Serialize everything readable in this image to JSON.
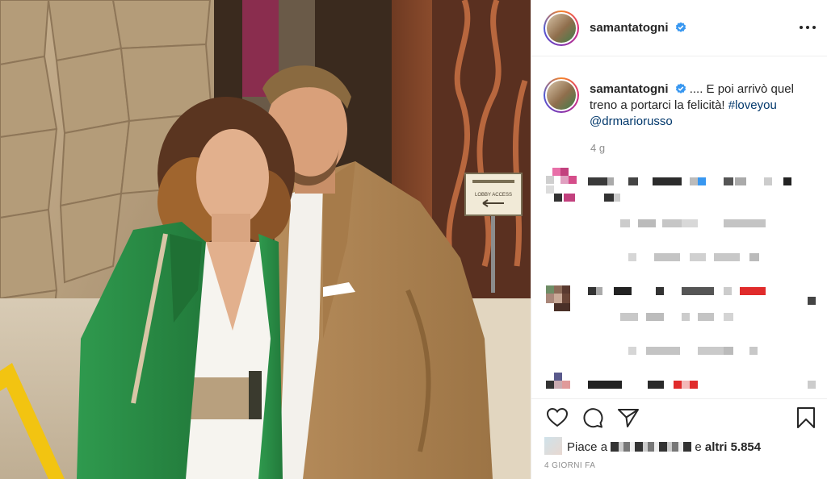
{
  "post": {
    "username": "samantatogni",
    "verified": true,
    "more_label": "Altre opzioni"
  },
  "caption": {
    "username": "samantatogni",
    "text": ".... E poi arrivò quel treno a portarci la felicità! ",
    "hashtag": "#loveyou",
    "mention": "@drmariorusso",
    "time": "4 g"
  },
  "likes": {
    "prefix": "Piace a ",
    "separator": " e ",
    "others": "altri 5.854"
  },
  "date": "4 GIORNI FA",
  "photo": {
    "sign_text": "LOBBY ACCESS"
  },
  "icons": {
    "like": "heart-icon",
    "comment": "comment-icon",
    "share": "paper-plane-icon",
    "save": "bookmark-icon",
    "more": "more-icon",
    "verified": "verified-badge-icon"
  },
  "colors": {
    "verified_blue": "#3897f0",
    "link_blue": "#00376b",
    "muted_gray": "#8e8e8e",
    "text_dark": "#262626"
  }
}
